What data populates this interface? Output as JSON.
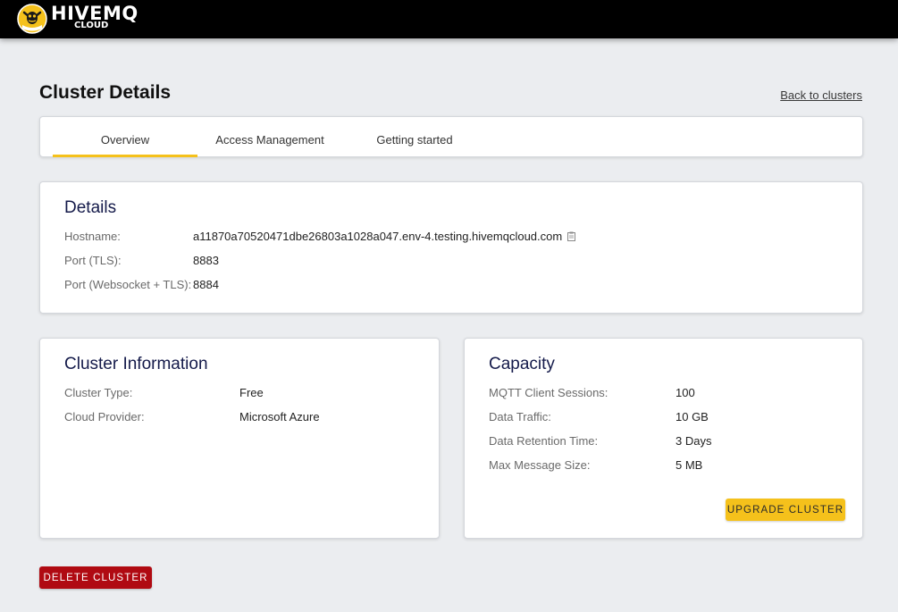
{
  "brand": {
    "name": "HIVEMQ",
    "sub": "CLOUD",
    "accent_color": "#f5c11b",
    "logo_icon": "hivemq-bee-logo-icon"
  },
  "header": {
    "title": "Cluster Details",
    "back_link": "Back to clusters"
  },
  "tabs": [
    {
      "label": "Overview",
      "active": true
    },
    {
      "label": "Access Management",
      "active": false
    },
    {
      "label": "Getting started",
      "active": false
    }
  ],
  "details": {
    "title": "Details",
    "rows": [
      {
        "label": "Hostname:",
        "value": "a11870a70520471dbe26803a1028a047.env-4.testing.hivemqcloud.com"
      },
      {
        "label": "Port (TLS):",
        "value": "8883"
      },
      {
        "label": "Port (Websocket + TLS):",
        "value": "8884"
      }
    ],
    "copy_icon": "clipboard-icon"
  },
  "cluster_info": {
    "title": "Cluster Information",
    "rows": [
      {
        "label": "Cluster Type:",
        "value": "Free"
      },
      {
        "label": "Cloud Provider:",
        "value": "Microsoft Azure"
      }
    ]
  },
  "capacity": {
    "title": "Capacity",
    "rows": [
      {
        "label": "MQTT Client Sessions:",
        "value": "100"
      },
      {
        "label": "Data Traffic:",
        "value": "10 GB"
      },
      {
        "label": "Data Retention Time:",
        "value": "3 Days"
      },
      {
        "label": "Max Message Size:",
        "value": "5 MB"
      }
    ],
    "upgrade_button": "UPGRADE CLUSTER"
  },
  "actions": {
    "delete_button": "DELETE CLUSTER",
    "delete_color": "#b00a12"
  }
}
